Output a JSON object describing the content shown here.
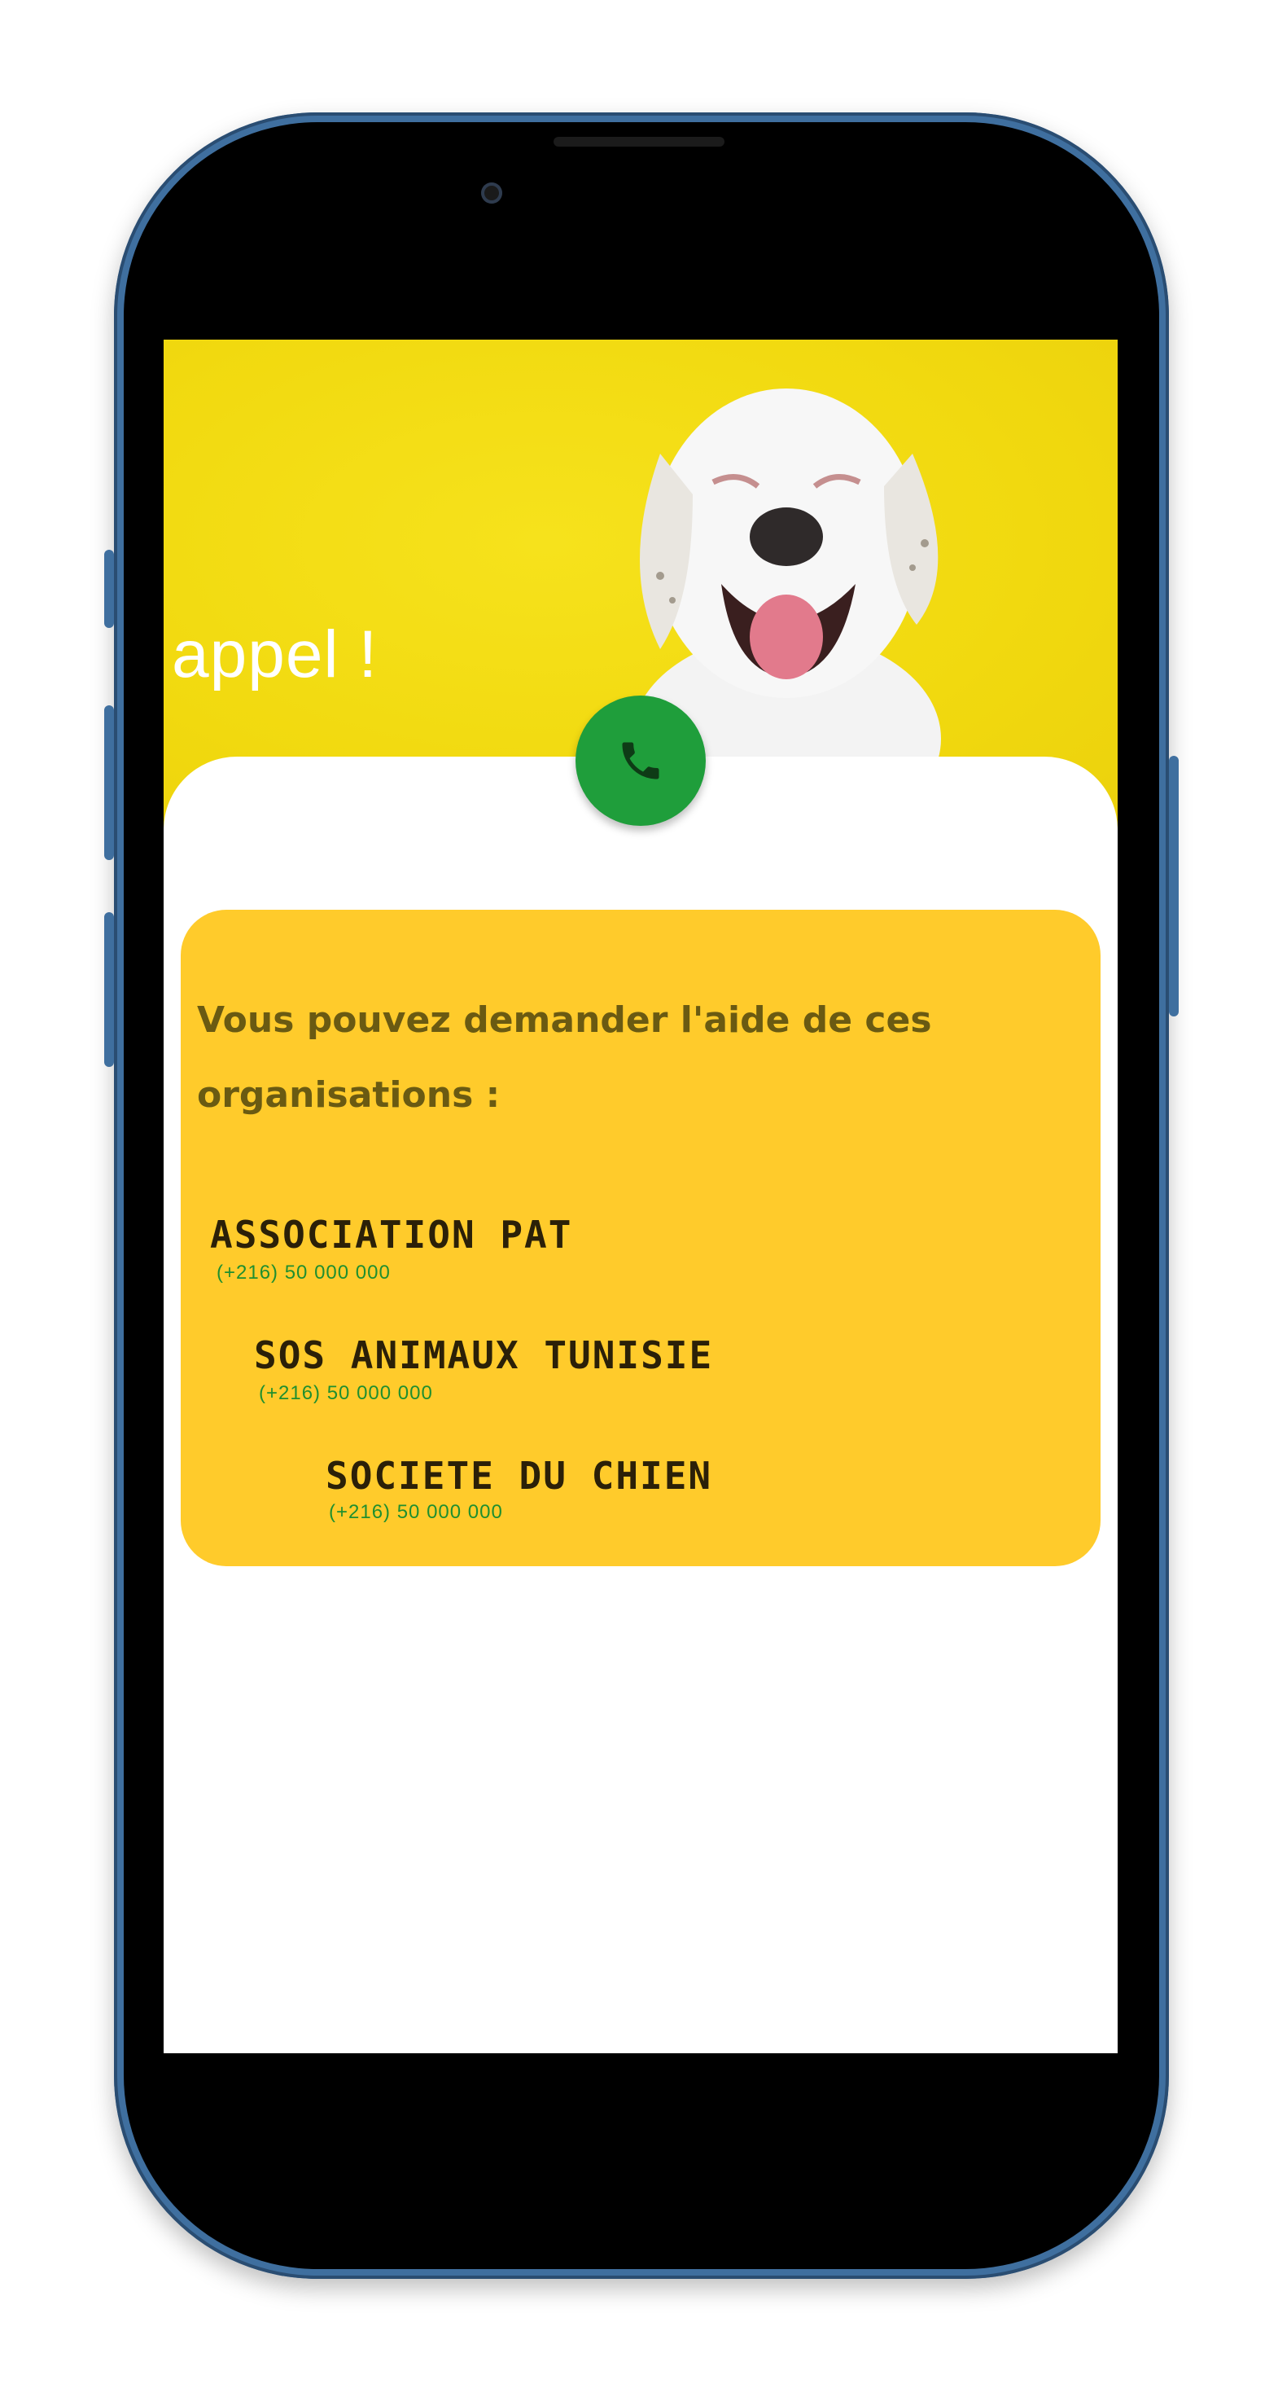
{
  "hero": {
    "title": "appel !"
  },
  "call_button": {
    "icon": "phone-icon",
    "color": "#1f9e3b"
  },
  "panel": {
    "intro": "Vous pouvez demander l'aide de ces organisations :",
    "organizations": [
      {
        "name": "ASSOCIATION PAT",
        "phone": "(+216) 50 000 000"
      },
      {
        "name": "SOS ANIMAUX TUNISIE",
        "phone": "(+216) 50 000 000"
      },
      {
        "name": "SOCIETE DU CHIEN",
        "phone": "(+216) 50 000 000"
      }
    ]
  },
  "colors": {
    "hero_bg": "#f1d90f",
    "panel_bg": "#ffcb2b",
    "phone_frame": "#3f6f9f"
  }
}
